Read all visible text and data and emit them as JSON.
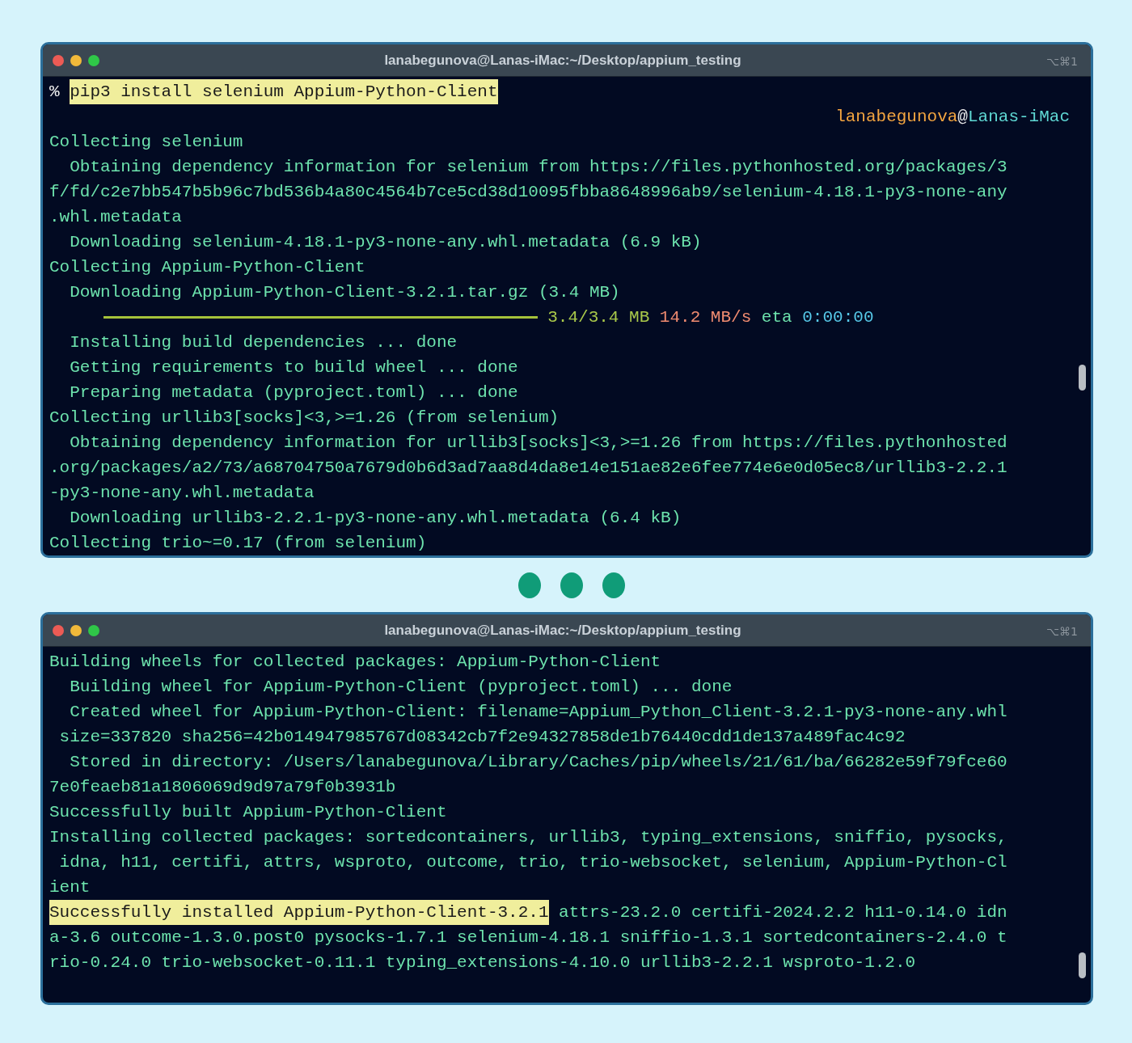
{
  "windows": [
    {
      "title": "lanabegunova@Lanas-iMac:~/Desktop/appium_testing",
      "shortcut": "⌥⌘1",
      "lines": [
        {
          "segments": [
            {
              "kind": "prompt",
              "text": "%"
            },
            {
              "kind": "highlight",
              "text": "pip3 install selenium Appium-Python-Client"
            }
          ]
        },
        {
          "right_aligned": true,
          "segments": [
            {
              "kind": "user",
              "text": "lanabegunova"
            },
            {
              "kind": "at",
              "text": "@"
            },
            {
              "kind": "host",
              "text": "Lanas-iMac"
            }
          ]
        },
        {
          "segments": [
            {
              "kind": "plain",
              "text": "Collecting selenium"
            }
          ]
        },
        {
          "segments": [
            {
              "kind": "plain",
              "text": "  Obtaining dependency information for selenium from https://files.pythonhosted.org/packages/3"
            }
          ]
        },
        {
          "segments": [
            {
              "kind": "plain",
              "text": "f/fd/c2e7bb547b5b96c7bd536b4a80c4564b7ce5cd38d10095fbba8648996ab9/selenium-4.18.1-py3-none-any"
            }
          ]
        },
        {
          "segments": [
            {
              "kind": "plain",
              "text": ".whl.metadata"
            }
          ]
        },
        {
          "segments": [
            {
              "kind": "plain",
              "text": "  Downloading selenium-4.18.1-py3-none-any.whl.metadata (6.9 kB)"
            }
          ]
        },
        {
          "segments": [
            {
              "kind": "plain",
              "text": "Collecting Appium-Python-Client"
            }
          ]
        },
        {
          "segments": [
            {
              "kind": "plain",
              "text": "  Downloading Appium-Python-Client-3.2.1.tar.gz (3.4 MB)"
            }
          ]
        },
        {
          "segments": [
            {
              "kind": "bar",
              "level": 1
            },
            {
              "kind": "size",
              "text": "3.4/3.4 MB"
            },
            {
              "kind": "speed",
              "text": "14.2 MB/s"
            },
            {
              "kind": "plain",
              "text": "eta"
            },
            {
              "kind": "eta",
              "text": "0:00:00"
            }
          ]
        },
        {
          "segments": [
            {
              "kind": "plain",
              "text": "  Installing build dependencies ... done"
            }
          ]
        },
        {
          "segments": [
            {
              "kind": "plain",
              "text": "  Getting requirements to build wheel ... done"
            }
          ]
        },
        {
          "segments": [
            {
              "kind": "plain",
              "text": "  Preparing metadata (pyproject.toml) ... done"
            }
          ]
        },
        {
          "segments": [
            {
              "kind": "plain",
              "text": "Collecting urllib3[socks]<3,>=1.26 (from selenium)"
            }
          ]
        },
        {
          "segments": [
            {
              "kind": "plain",
              "text": "  Obtaining dependency information for urllib3[socks]<3,>=1.26 from https://files.pythonhosted"
            }
          ]
        },
        {
          "segments": [
            {
              "kind": "plain",
              "text": ".org/packages/a2/73/a68704750a7679d0b6d3ad7aa8d4da8e14e151ae82e6fee774e6e0d05ec8/urllib3-2.2.1"
            }
          ]
        },
        {
          "segments": [
            {
              "kind": "plain",
              "text": "-py3-none-any.whl.metadata"
            }
          ]
        },
        {
          "segments": [
            {
              "kind": "plain",
              "text": "  Downloading urllib3-2.2.1-py3-none-any.whl.metadata (6.4 kB)"
            }
          ]
        },
        {
          "segments": [
            {
              "kind": "plain",
              "text": "Collecting trio~=0.17 (from selenium)"
            }
          ]
        }
      ]
    },
    {
      "title": "lanabegunova@Lanas-iMac:~/Desktop/appium_testing",
      "shortcut": "⌥⌘1",
      "lines": [
        {
          "segments": [
            {
              "kind": "plain",
              "text": "Building wheels for collected packages: Appium-Python-Client"
            }
          ]
        },
        {
          "segments": [
            {
              "kind": "plain",
              "text": "  Building wheel for Appium-Python-Client (pyproject.toml) ... done"
            }
          ]
        },
        {
          "segments": [
            {
              "kind": "plain",
              "text": "  Created wheel for Appium-Python-Client: filename=Appium_Python_Client-3.2.1-py3-none-any.whl"
            }
          ]
        },
        {
          "segments": [
            {
              "kind": "plain",
              "text": " size=337820 sha256=42b014947985767d08342cb7f2e94327858de1b76440cdd1de137a489fac4c92"
            }
          ]
        },
        {
          "segments": [
            {
              "kind": "plain",
              "text": "  Stored in directory: /Users/lanabegunova/Library/Caches/pip/wheels/21/61/ba/66282e59f79fce60"
            }
          ]
        },
        {
          "segments": [
            {
              "kind": "plain",
              "text": "7e0feaeb81a1806069d9d97a79f0b3931b"
            }
          ]
        },
        {
          "segments": [
            {
              "kind": "plain",
              "text": "Successfully built Appium-Python-Client"
            }
          ]
        },
        {
          "segments": [
            {
              "kind": "plain",
              "text": "Installing collected packages: sortedcontainers, urllib3, typing_extensions, sniffio, pysocks,"
            }
          ]
        },
        {
          "segments": [
            {
              "kind": "plain",
              "text": " idna, h11, certifi, attrs, wsproto, outcome, trio, trio-websocket, selenium, Appium-Python-Cl"
            }
          ]
        },
        {
          "segments": [
            {
              "kind": "plain",
              "text": "ient"
            }
          ]
        },
        {
          "segments": [
            {
              "kind": "highlight",
              "text": "Successfully installed Appium-Python-Client-3.2.1"
            },
            {
              "kind": "plain",
              "text": "attrs-23.2.0 certifi-2024.2.2 h11-0.14.0 idn"
            }
          ]
        },
        {
          "segments": [
            {
              "kind": "plain",
              "text": "a-3.6 outcome-1.3.0.post0 pysocks-1.7.1 selenium-4.18.1 sniffio-1.3.1 sortedcontainers-2.4.0 t"
            }
          ]
        },
        {
          "segments": [
            {
              "kind": "plain",
              "text": "rio-0.24.0 trio-websocket-0.11.1 typing_extensions-4.10.0 urllib3-2.2.1 wsproto-1.2.0"
            }
          ]
        }
      ]
    }
  ]
}
